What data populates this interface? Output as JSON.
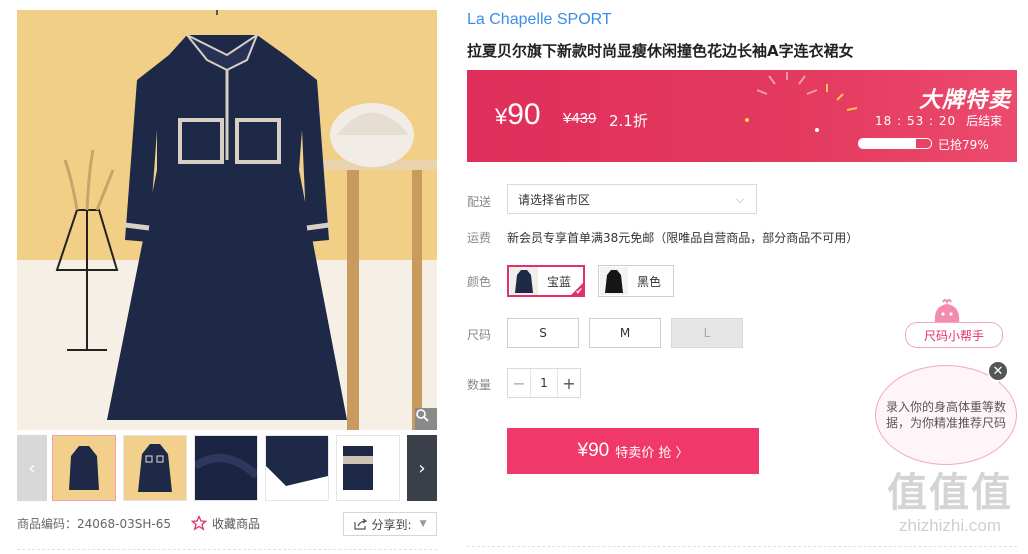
{
  "product": {
    "brand": "La Chapelle SPORT",
    "title": "拉夏贝尔旗下新款时尚显瘦休闲撞色花边长袖A字连衣裙女"
  },
  "price": {
    "current": "90",
    "currency": "¥",
    "original": "¥439",
    "discount": "2.1折"
  },
  "sale": {
    "title": "大牌特卖",
    "countdown": "18 : 53 : 20",
    "countdown_suffix": "后结束",
    "progress_label": "已抢79%",
    "progress_percent": 79
  },
  "delivery": {
    "label": "配送",
    "placeholder": "请选择省市区"
  },
  "shipping": {
    "label": "运费",
    "text": "新会员专享首单满38元免邮（限唯品自营商品，部分商品不可用）"
  },
  "color": {
    "label": "颜色",
    "options": [
      {
        "name": "宝蓝",
        "selected": true
      },
      {
        "name": "黑色",
        "selected": false
      }
    ]
  },
  "size": {
    "label": "尺码",
    "options": [
      {
        "name": "S",
        "available": true
      },
      {
        "name": "M",
        "available": true
      },
      {
        "name": "L",
        "available": false
      }
    ]
  },
  "quantity": {
    "label": "数量",
    "value": "1",
    "minus": "−",
    "plus": "+"
  },
  "buy_button": {
    "price": "¥90",
    "label": "特卖价 抢 〉"
  },
  "gallery": {
    "sku_code": "商品编码：24068-03SH-65",
    "favorite": "收藏商品",
    "share": "分享到:",
    "thumbnails": 6
  },
  "size_helper": {
    "title": "尺码小帮手",
    "bubble": "录入你的身高体重等数据，为你精准推荐尺码",
    "close": "✕"
  },
  "watermark": {
    "big": "值值值",
    "small": "zhizhizhi.com"
  },
  "colors": {
    "accent": "#e0316a",
    "brand_blue": "#3a8ee6",
    "banner": "#e02e5a",
    "dress": "#1e2847"
  }
}
